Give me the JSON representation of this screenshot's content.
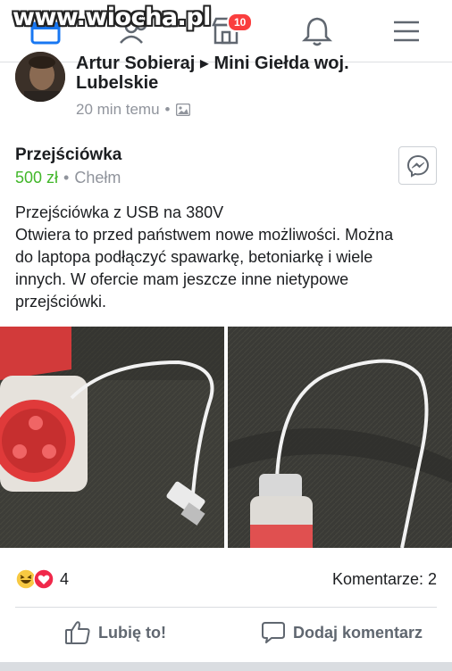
{
  "watermark": "www.wiocha.pl",
  "nav": {
    "marketplace_badge": "10",
    "icons": [
      "home-icon",
      "friends-icon",
      "marketplace-icon",
      "bell-icon",
      "menu-icon"
    ]
  },
  "post": {
    "author_partial": "Artur Sobieraj ▸ Mini Giełda woj.",
    "group": "Lubelskie",
    "time": "20 min temu",
    "dot": "•"
  },
  "listing": {
    "title": "Przejściówka",
    "price": "500 zł",
    "separator": "•",
    "location": "Chełm",
    "description": [
      "Przejściówka z USB na 380V",
      "Otwiera to przed państwem nowe możliwości. Można",
      "do laptopa podłączyć spawarkę, betoniarkę i wiele",
      "innych. W ofercie mam jeszcze inne nietypowe",
      "przejściówki."
    ]
  },
  "reactions": {
    "count": "4",
    "comments": "Komentarze: 2"
  },
  "actions": {
    "like": "Lubię to!",
    "comment": "Dodaj komentarz"
  },
  "colors": {
    "price_green": "#42b72a",
    "meta_gray": "#90949c",
    "badge_red": "#fa3e3e",
    "fb_blue": "#1877f2"
  }
}
